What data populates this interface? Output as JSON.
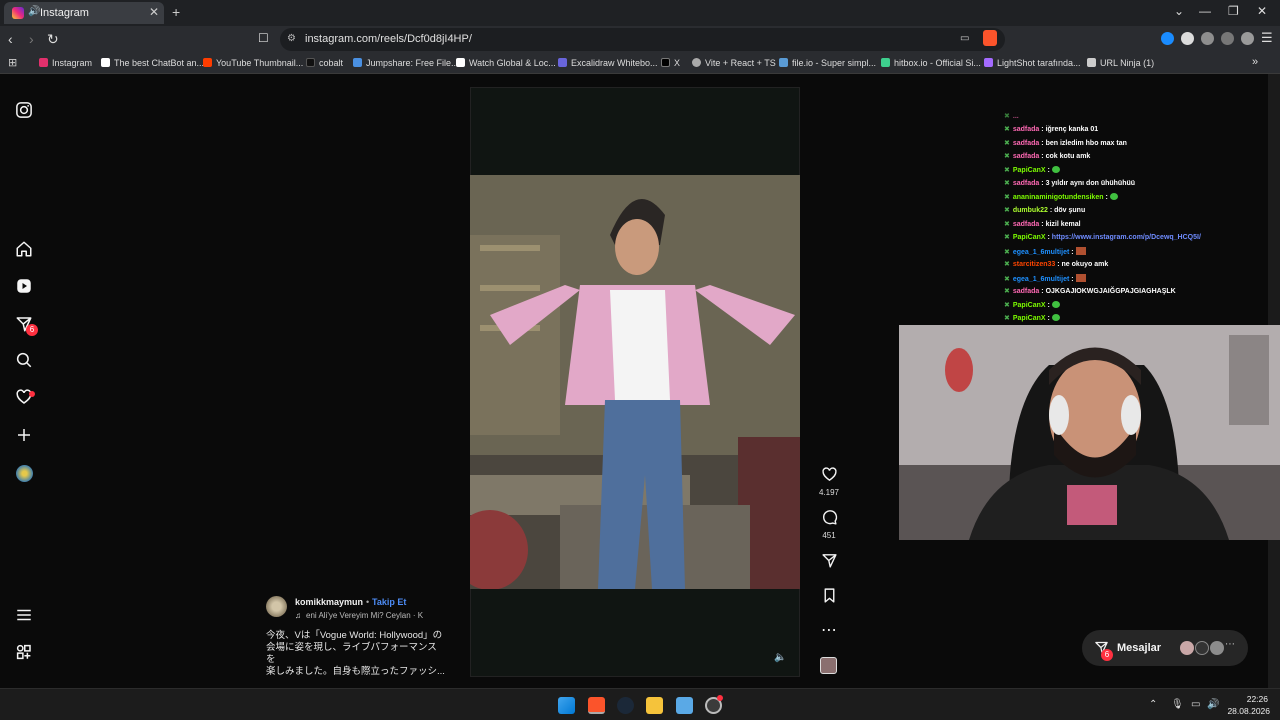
{
  "browser": {
    "tab_title": "Instagram",
    "url": "instagram.com/reels/Dcf0d8jI4HP/",
    "bookmarks": [
      "Instagram",
      "The best ChatBot an...",
      "YouTube Thumbnail...",
      "cobalt",
      "Jumpshare: Free File...",
      "Watch Global & Loc...",
      "Excalidraw Whitebo...",
      "X",
      "Vite + React + TS",
      "file.io - Super simpl...",
      "hitbox.io - Official Si...",
      "LightShot tarafında...",
      "URL Ninja (1)"
    ]
  },
  "sidebar": {
    "notifications_badge": "6"
  },
  "reel": {
    "username": "komikkmaymun",
    "follow_label": "Takip Et",
    "audio_label": "eni Ali'ye Vereyim Mi?  Ceylan · K",
    "caption_line1": "今夜、Vは「Vogue World: Hollywood」の",
    "caption_line2": "会場に姿を現し、ライブパフォーマンスを",
    "caption_line3": "楽しみました。自身も際立ったファッシ...",
    "likes": "4.197",
    "comments": "451"
  },
  "chat": {
    "partial_top": "...",
    "lines": [
      {
        "user": "sadfada",
        "msg": "iğrenç kanka 01",
        "color": "#ff69b4"
      },
      {
        "user": "sadfada",
        "msg": "ben izledim hbo max tan",
        "color": "#ff69b4"
      },
      {
        "user": "sadfada",
        "msg": "cok kotu amk",
        "color": "#ff69b4"
      },
      {
        "user": "PapiCanX",
        "msg": "",
        "color": "#7cfc00",
        "emote": "green"
      },
      {
        "user": "sadfada",
        "msg": "3 yıldır aynı don ühühühüü",
        "color": "#ff69b4"
      },
      {
        "user": "ananinaminigotundensiken",
        "msg": "",
        "color": "#7cfc00",
        "emote": "green"
      },
      {
        "user": "dumbuk22",
        "msg": "döv şunu",
        "color": "#adff2f"
      },
      {
        "user": "sadfada",
        "msg": "kizil kemal",
        "color": "#ff69b4"
      },
      {
        "user": "PapiCanX",
        "msg": "https://www.instagram.com/p/Dcewq_HCQ5I/",
        "color": "#7cfc00",
        "link": true
      },
      {
        "user": "egea_1_6multijet",
        "msg": "",
        "color": "#1e90ff",
        "emote": "red"
      },
      {
        "user": "starcitizen33",
        "msg": "ne okuyo amk",
        "color": "#ff4500"
      },
      {
        "user": "egea_1_6multijet",
        "msg": "",
        "color": "#1e90ff",
        "emote": "red"
      },
      {
        "user": "sadfada",
        "msg": "OJKGAJIOKWGJAIĞGPAJGIAGHAŞLK",
        "color": "#ff69b4"
      },
      {
        "user": "PapiCanX",
        "msg": "",
        "color": "#7cfc00",
        "emote": "green"
      },
      {
        "user": "PapiCanX",
        "msg": "",
        "color": "#7cfc00",
        "emote": "green"
      }
    ]
  },
  "messages": {
    "label": "Mesajlar",
    "badge": "6"
  },
  "taskbar": {
    "time": "22:26",
    "date": "28.08.2026"
  }
}
